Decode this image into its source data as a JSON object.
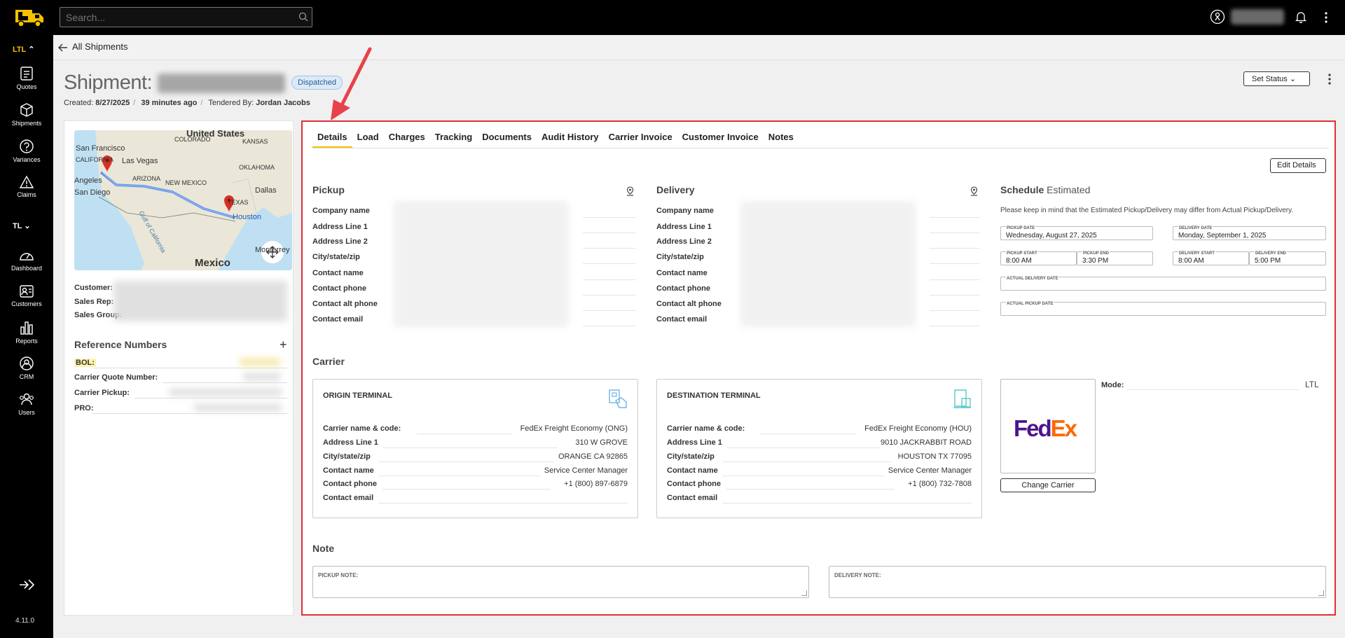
{
  "app": {
    "version": "4.11.0"
  },
  "topbar": {
    "search_placeholder": "Search..."
  },
  "sidebar": {
    "mode_ltl": "LTL",
    "mode_tl": "TL",
    "items": [
      {
        "label": "Quotes",
        "icon": "quotes-icon"
      },
      {
        "label": "Shipments",
        "icon": "shipments-icon"
      },
      {
        "label": "Variances",
        "icon": "variances-icon"
      },
      {
        "label": "Claims",
        "icon": "claims-icon"
      },
      {
        "label": "Dashboard",
        "icon": "dashboard-icon"
      },
      {
        "label": "Customers",
        "icon": "customers-icon"
      },
      {
        "label": "Reports",
        "icon": "reports-icon"
      },
      {
        "label": "CRM",
        "icon": "crm-icon"
      },
      {
        "label": "Users",
        "icon": "users-icon"
      }
    ]
  },
  "breadcrumb": {
    "back_label": "All Shipments"
  },
  "shipment": {
    "title": "Shipment:",
    "status": "Dispatched",
    "created_label": "Created:",
    "created_date": "8/27/2025",
    "age": "39 minutes ago",
    "tendered_label": "Tendered By:",
    "tendered_by": "Jordan Jacobs",
    "set_status_label": "Set Status"
  },
  "map": {
    "labels": [
      "United States",
      "San Francisco",
      "Las Vegas",
      "COLORADO",
      "KANSAS",
      "CALIFORNIA",
      "ARIZONA",
      "OKLAHOMA",
      "NEW MEXICO",
      "Dallas",
      "Angeles",
      "San Diego",
      "TEXAS",
      "Houston",
      "Gulf of California",
      "Monterrey",
      "Mexico"
    ]
  },
  "customer_info": {
    "customer_label": "Customer:",
    "sales_rep_label": "Sales Rep:",
    "sales_group_label": "Sales Group:"
  },
  "references": {
    "title": "Reference Numbers",
    "rows": [
      "BOL:",
      "Carrier Quote Number:",
      "Carrier Pickup:",
      "PRO:"
    ]
  },
  "tabs": [
    "Details",
    "Load",
    "Charges",
    "Tracking",
    "Documents",
    "Audit History",
    "Carrier Invoice",
    "Customer Invoice",
    "Notes"
  ],
  "details": {
    "edit_label": "Edit Details",
    "pickup_title": "Pickup",
    "delivery_title": "Delivery",
    "address_fields": [
      "Company name",
      "Address Line 1",
      "Address Line 2",
      "City/state/zip",
      "Contact name",
      "Contact phone",
      "Contact alt phone",
      "Contact email"
    ],
    "schedule_title": "Schedule",
    "schedule_subtitle": "Estimated",
    "schedule_note": "Please keep in mind that the Estimated Pickup/Delivery may differ from Actual Pickup/Delivery.",
    "pickup_date_label": "PICKUP DATE",
    "pickup_date": "Wednesday, August 27, 2025",
    "delivery_date_label": "DELIVERY DATE",
    "delivery_date": "Monday, September 1, 2025",
    "pickup_start_label": "PICKUP START",
    "pickup_start": "8:00 AM",
    "pickup_end_label": "PICKUP END",
    "pickup_end": "3:30 PM",
    "delivery_start_label": "DELIVERY START",
    "delivery_start": "8:00 AM",
    "delivery_end_label": "DELIVERY END",
    "delivery_end": "5:00 PM",
    "actual_delivery_label": "ACTUAL DELIVERY DATE",
    "actual_pickup_label": "ACTUAL PICKUP DATE"
  },
  "carrier": {
    "title": "Carrier",
    "row_labels": [
      "Carrier name & code:",
      "Address Line 1",
      "City/state/zip",
      "Contact name",
      "Contact phone",
      "Contact email"
    ],
    "origin": {
      "title": "ORIGIN TERMINAL",
      "values": [
        "FedEx Freight Economy (ONG)",
        "310 W GROVE",
        "ORANGE CA 92865",
        "Service Center Manager",
        "+1 (800) 897-6879",
        ""
      ]
    },
    "destination": {
      "title": "DESTINATION TERMINAL",
      "values": [
        "FedEx Freight Economy (HOU)",
        "9010 JACKRABBIT ROAD",
        "HOUSTON TX 77095",
        "Service Center Manager",
        "+1 (800) 732-7808",
        ""
      ]
    },
    "logo_fed": "Fed",
    "logo_ex": "Ex",
    "brand_purple": "#4d148c",
    "brand_orange": "#ff6600",
    "change_label": "Change Carrier",
    "mode_label": "Mode:",
    "mode_value": "LTL"
  },
  "note": {
    "title": "Note",
    "pickup_label": "PICKUP NOTE:",
    "delivery_label": "DELIVERY NOTE:"
  },
  "colors": {
    "accent": "#f6c100",
    "highlight": "#e0303a"
  }
}
